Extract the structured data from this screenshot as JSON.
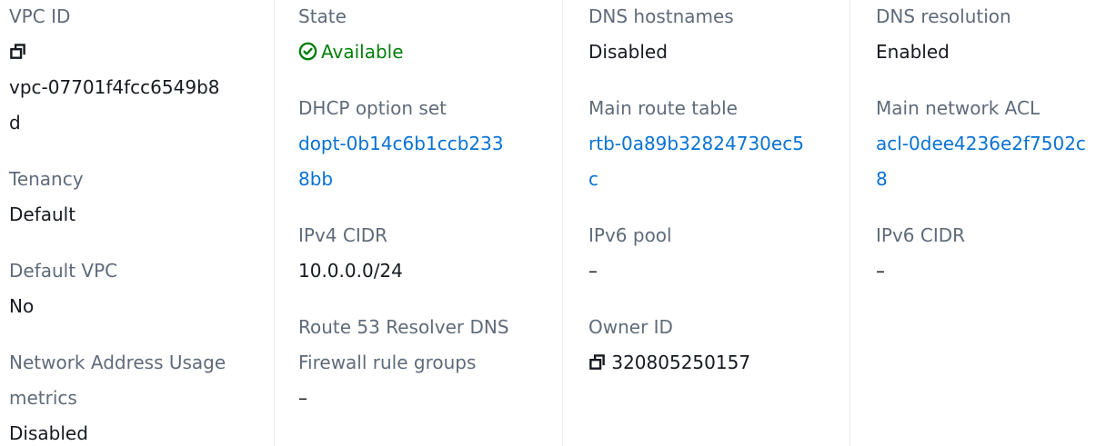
{
  "col1": {
    "vpc_id_label": "VPC ID",
    "vpc_id_l1": "vpc-07701f4fcc6549b8",
    "vpc_id_l2": "d",
    "tenancy_label": "Tenancy",
    "tenancy_value": "Default",
    "default_vpc_label": "Default VPC",
    "default_vpc_value": "No",
    "nau_label_l1": "Network Address Usage",
    "nau_label_l2": "metrics",
    "nau_value": "Disabled"
  },
  "col2": {
    "state_label": "State",
    "state_value": "Available",
    "dhcp_label": "DHCP option set",
    "dhcp_l1": "dopt-0b14c6b1ccb233",
    "dhcp_l2": "8bb",
    "ipv4_label": "IPv4 CIDR",
    "ipv4_value": "10.0.0.0/24",
    "r53_label_l1": "Route 53 Resolver DNS",
    "r53_label_l2": "Firewall rule groups",
    "r53_value": "–"
  },
  "col3": {
    "dns_hostnames_label": "DNS hostnames",
    "dns_hostnames_value": "Disabled",
    "main_rt_label": "Main route table",
    "main_rt_l1": "rtb-0a89b32824730ec5",
    "main_rt_l2": "c",
    "ipv6_pool_label": "IPv6 pool",
    "ipv6_pool_value": "–",
    "owner_label": "Owner ID",
    "owner_value": "320805250157"
  },
  "col4": {
    "dns_resolution_label": "DNS resolution",
    "dns_resolution_value": "Enabled",
    "main_acl_label": "Main network ACL",
    "main_acl_l1": "acl-0dee4236e2f7502c",
    "main_acl_l2": "8",
    "ipv6_cidr_label": "IPv6 CIDR",
    "ipv6_cidr_value": "–"
  },
  "colors": {
    "label": "#5f6b7a",
    "link": "#0972d3",
    "success": "#037f0c",
    "text": "#16191f",
    "divider": "#e9ebed"
  },
  "icons": {
    "copy": "copy-icon",
    "status": "check-circle-icon"
  }
}
